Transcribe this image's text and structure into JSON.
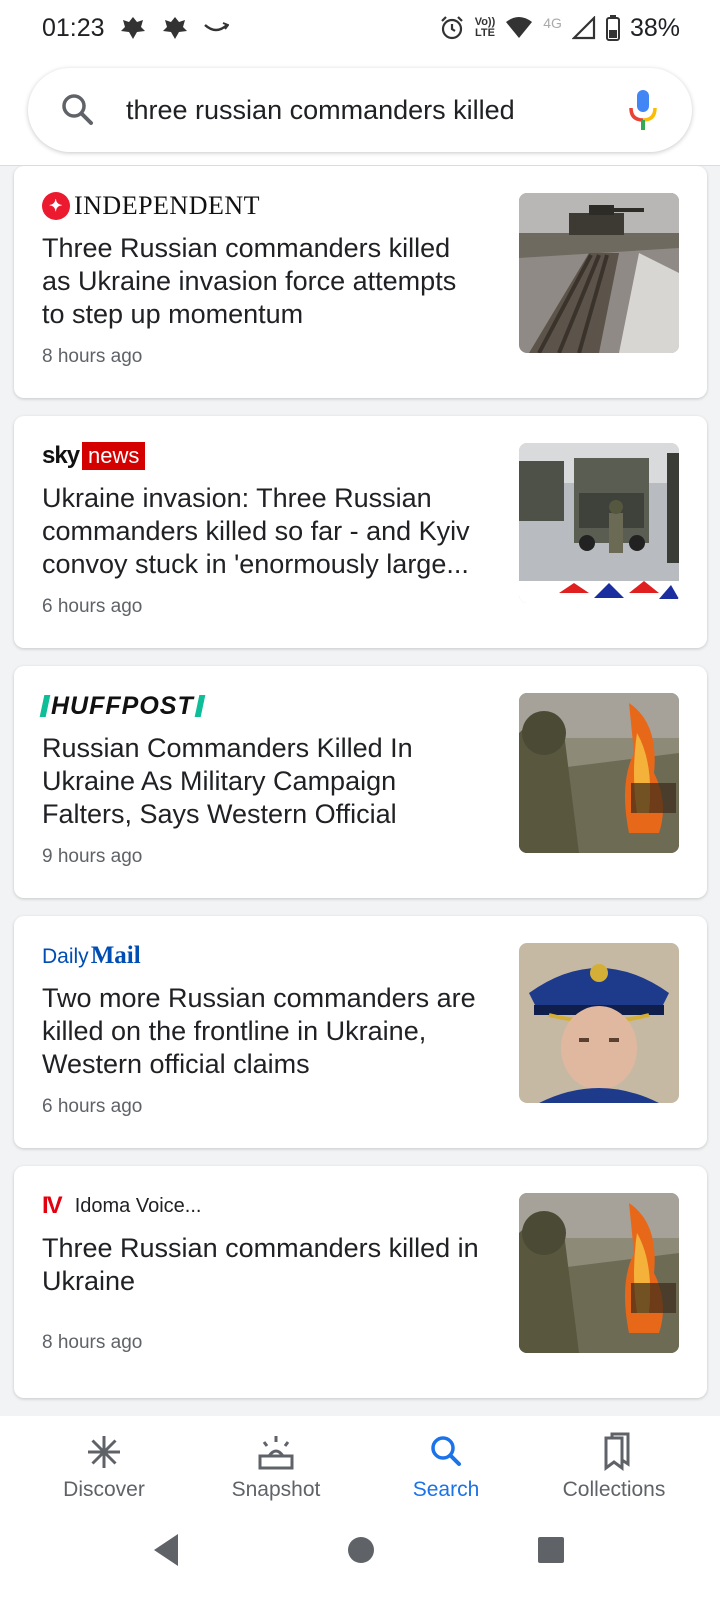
{
  "status_bar": {
    "time": "01:23",
    "network_label": "4G",
    "lte_label": "LTE",
    "battery": "38%"
  },
  "search": {
    "query": "three russian commanders killed",
    "icon": "search-icon",
    "mic_icon": "mic-icon"
  },
  "articles": [
    {
      "source": "INDEPENDENT",
      "headline": "Three Russian commanders killed as Ukraine invasion force attempts to step up momentum",
      "time": "8 hours ago",
      "thumb": "tank-on-muddy-road"
    },
    {
      "source_sky": "sky",
      "source_news": "news",
      "headline": "Ukraine invasion: Three Russian commanders killed so far - and Kyiv convoy stuck in 'enormously large...",
      "time": "6 hours ago",
      "thumb": "military-trucks-soldier"
    },
    {
      "source": "HUFFPOST",
      "headline": "Russian Commanders Killed In Ukraine As Military Campaign Falters, Says Western Official",
      "time": "9 hours ago",
      "thumb": "soldier-burning-vehicle"
    },
    {
      "source_daily": "Daily",
      "source_mail": "Mail",
      "headline": "Two more Russian commanders are killed on the frontline in Ukraine, Western official claims",
      "time": "6 hours ago",
      "thumb": "officer-portrait"
    },
    {
      "source_logo": "IV",
      "source": "Idoma Voice...",
      "headline": "Three Russian commanders killed in Ukraine",
      "time": "8 hours ago",
      "thumb": "soldier-burning-vehicle"
    }
  ],
  "bottom_nav": [
    {
      "label": "Discover",
      "icon": "asterisk-icon",
      "active": false
    },
    {
      "label": "Snapshot",
      "icon": "snapshot-icon",
      "active": false
    },
    {
      "label": "Search",
      "icon": "search-icon",
      "active": true
    },
    {
      "label": "Collections",
      "icon": "bookmarks-icon",
      "active": false
    }
  ],
  "colors": {
    "accent": "#1a73e8",
    "text": "#202124",
    "secondary_text": "#5f6368",
    "background": "#f1f3f4"
  }
}
